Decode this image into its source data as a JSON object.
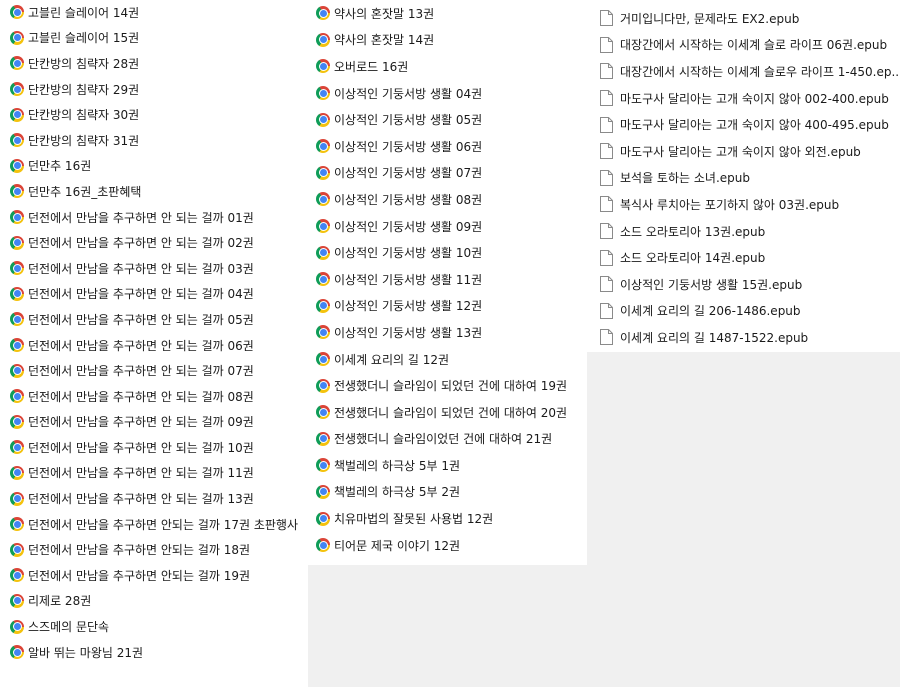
{
  "column1": {
    "icon": "chrome-icon",
    "items": [
      "고블린 슬레이어 14권",
      "고블린 슬레이어 15권",
      "단칸방의 침략자 28권",
      "단칸방의 침략자 29권",
      "단칸방의 침략자 30권",
      "단칸방의 침략자 31권",
      "던만추 16권",
      "던만추 16권_초판혜택",
      "던전에서 만남을 추구하면 안 되는 걸까 01권",
      "던전에서 만남을 추구하면 안 되는 걸까 02권",
      "던전에서 만남을 추구하면 안 되는 걸까 03권",
      "던전에서 만남을 추구하면 안 되는 걸까 04권",
      "던전에서 만남을 추구하면 안 되는 걸까 05권",
      "던전에서 만남을 추구하면 안 되는 걸까 06권",
      "던전에서 만남을 추구하면 안 되는 걸까 07권",
      "던전에서 만남을 추구하면 안 되는 걸까 08권",
      "던전에서 만남을 추구하면 안 되는 걸까 09권",
      "던전에서 만남을 추구하면 안 되는 걸까 10권",
      "던전에서 만남을 추구하면 안 되는 걸까 11권",
      "던전에서 만남을 추구하면 안 되는 걸까 13권",
      "던전에서 만남을 추구하면 안되는 걸까 17권 초판행사",
      "던전에서 만남을 추구하면 안되는 걸까 18권",
      "던전에서 만남을 추구하면 안되는 걸까 19권",
      "리제로 28권",
      "스즈메의 문단속",
      "알바 뛰는 마왕님 21권"
    ]
  },
  "column2": {
    "icon": "chrome-icon",
    "items": [
      "약사의 혼잣말 13권",
      "약사의 혼잣말 14권",
      "오버로드 16권",
      "이상적인 기둥서방 생활 04권",
      "이상적인 기둥서방 생활 05권",
      "이상적인 기둥서방 생활 06권",
      "이상적인 기둥서방 생활 07권",
      "이상적인 기둥서방 생활 08권",
      "이상적인 기둥서방 생활 09권",
      "이상적인 기둥서방 생활 10권",
      "이상적인 기둥서방 생활 11권",
      "이상적인 기둥서방 생활 12권",
      "이상적인 기둥서방 생활 13권",
      "이세계 요리의 길 12권",
      "전생했더니 슬라임이 되었던 건에 대하여 19권",
      "전생했더니 슬라임이 되었던 건에 대하여 20권",
      "전생했더니 슬라임이었던 건에 대하여 21권",
      "책벌레의 하극상 5부 1권",
      "책벌레의 하극상 5부 2권",
      "치유마법의 잘못된 사용법 12권",
      "티어문 제국 이야기 12권"
    ]
  },
  "column3": {
    "icon": "file-icon",
    "items": [
      "거미입니다만, 문제라도 EX2.epub",
      "대장간에서 시작하는 이세계 슬로 라이프 06권.epub",
      "대장간에서 시작하는 이세계 슬로우 라이프 1-450.ep...",
      "마도구사 달리아는 고개 숙이지 않아 002-400.epub",
      "마도구사 달리아는 고개 숙이지 않아 400-495.epub",
      "마도구사 달리아는 고개 숙이지 않아 외전.epub",
      "보석을 토하는 소녀.epub",
      "복식사 루치아는 포기하지 않아 03권.epub",
      "소드 오라토리아 13권.epub",
      "소드 오라토리아 14권.epub",
      "이상적인 기둥서방 생활 15권.epub",
      "이세계 요리의 길 206-1486.epub",
      "이세계 요리의 길 1487-1522.epub"
    ]
  },
  "colors": {
    "list_background": "#ffffff",
    "empty_background": "#f0f0f0",
    "text": "#1a1a1a"
  }
}
